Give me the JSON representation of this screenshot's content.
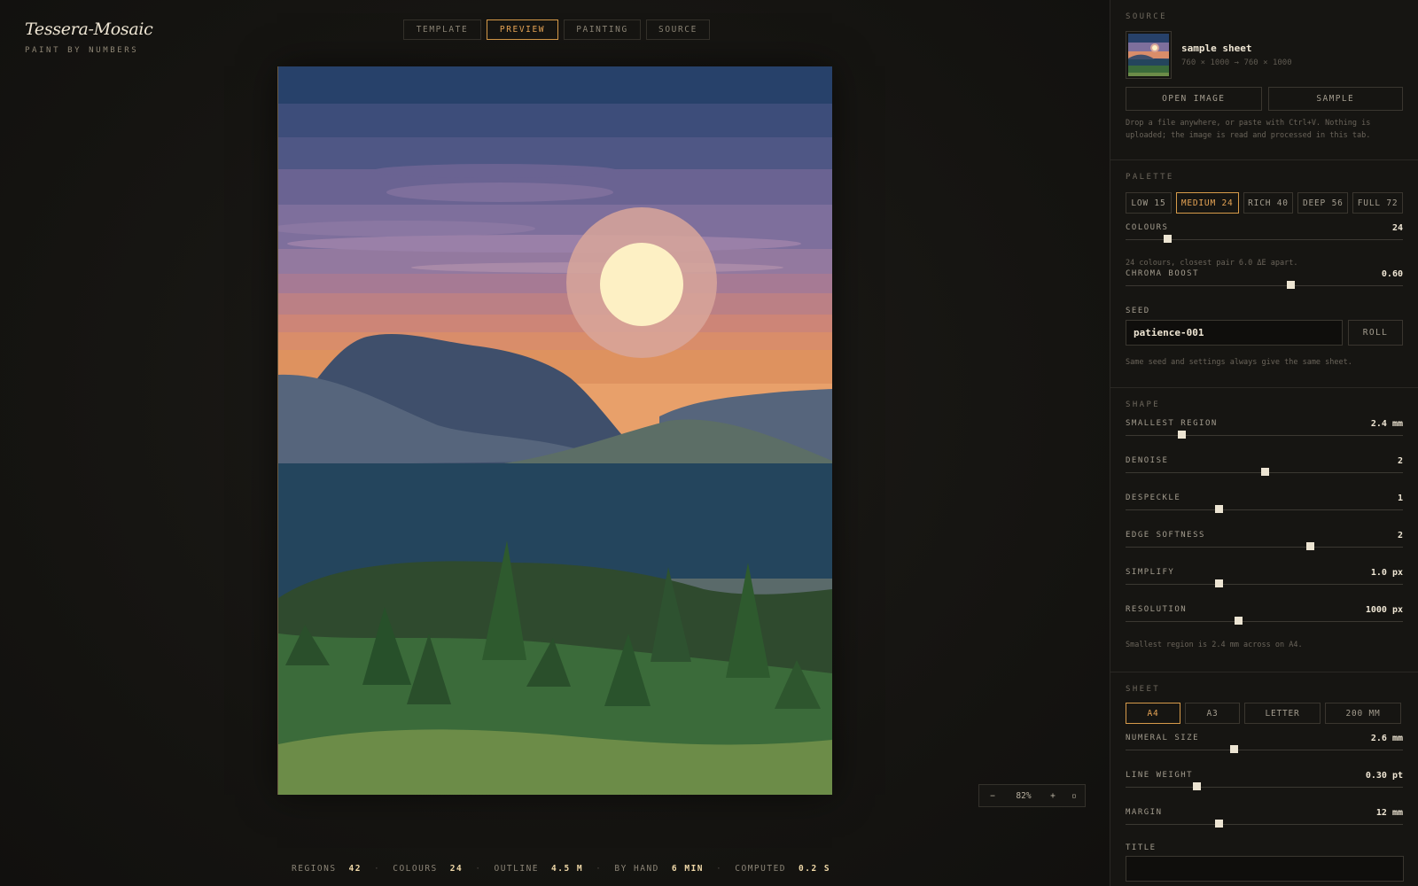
{
  "brand": {
    "name": "Tessera-Mosaic",
    "tagline": "PAINT BY NUMBERS"
  },
  "tabs": [
    {
      "label": "TEMPLATE",
      "active": false
    },
    {
      "label": "PREVIEW",
      "active": true
    },
    {
      "label": "PAINTING",
      "active": false
    },
    {
      "label": "SOURCE",
      "active": false
    }
  ],
  "zoom": {
    "minus": "−",
    "level": "82%",
    "plus": "+",
    "fit": "▫"
  },
  "stats": [
    {
      "label": "REGIONS",
      "value": "42"
    },
    {
      "label": "COLOURS",
      "value": "24"
    },
    {
      "label": "OUTLINE",
      "value": "4.5 M"
    },
    {
      "label": "BY HAND",
      "value": "6 MIN"
    },
    {
      "label": "COMPUTED",
      "value": "0.2 S"
    }
  ],
  "separator": "·",
  "source": {
    "title": "SOURCE",
    "name": "sample sheet",
    "dims": "760 × 1000 → 760 × 1000",
    "open_label": "OPEN IMAGE",
    "sample_label": "SAMPLE",
    "hint": "Drop a file anywhere, or paste with Ctrl+V. Nothing is uploaded; the image is read and processed in this tab."
  },
  "palette": {
    "title": "PALETTE",
    "presets": [
      {
        "label": "LOW 15",
        "active": false
      },
      {
        "label": "MEDIUM 24",
        "active": true
      },
      {
        "label": "RICH 40",
        "active": false
      },
      {
        "label": "DEEP 56",
        "active": false
      },
      {
        "label": "FULL 72",
        "active": false
      }
    ],
    "colours": {
      "label": "COLOURS",
      "value": "24",
      "fraction": 0.15
    },
    "colours_hint": "24 colours, closest pair 6.0 ΔE apart.",
    "chroma": {
      "label": "CHROMA BOOST",
      "value": "0.60",
      "fraction": 0.595
    },
    "seed_label": "SEED",
    "seed_value": "patience-001",
    "roll_label": "ROLL",
    "seed_hint": "Same seed and settings always give the same sheet."
  },
  "shape": {
    "title": "SHAPE",
    "controls": [
      {
        "label": "SMALLEST REGION",
        "value": "2.4 mm",
        "fraction": 0.2
      },
      {
        "label": "DENOISE",
        "value": "2",
        "fraction": 0.5
      },
      {
        "label": "DESPECKLE",
        "value": "1",
        "fraction": 0.335
      },
      {
        "label": "EDGE SOFTNESS",
        "value": "2",
        "fraction": 0.665
      },
      {
        "label": "SIMPLIFY",
        "value": "1.0 px",
        "fraction": 0.335
      },
      {
        "label": "RESOLUTION",
        "value": "1000 px",
        "fraction": 0.405
      }
    ],
    "hint": "Smallest region is 2.4 mm across on A4."
  },
  "sheet": {
    "title": "SHEET",
    "sizes": [
      {
        "label": "A4",
        "active": true
      },
      {
        "label": "A3",
        "active": false
      },
      {
        "label": "LETTER",
        "active": false
      },
      {
        "label": "200 MM",
        "active": false
      }
    ],
    "controls": [
      {
        "label": "NUMERAL SIZE",
        "value": "2.6 mm",
        "fraction": 0.39
      },
      {
        "label": "LINE WEIGHT",
        "value": "0.30 pt",
        "fraction": 0.255
      },
      {
        "label": "MARGIN",
        "value": "12 mm",
        "fraction": 0.335
      }
    ],
    "title_label": "TITLE",
    "title_value": ""
  },
  "colors": {
    "accent": "#d79b4a",
    "sky_top": "#27416a",
    "sun": "#fdf0c4",
    "lake": "#24455d",
    "forest": "#3b6b3a",
    "meadow": "#6c8c48"
  }
}
